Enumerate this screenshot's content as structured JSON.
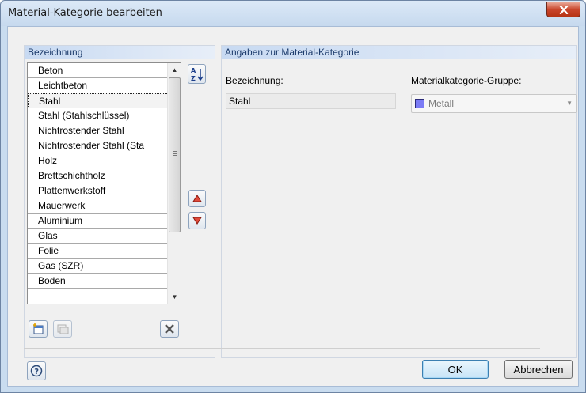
{
  "window": {
    "title": "Material-Kategorie bearbeiten",
    "close_label": "x"
  },
  "left_panel": {
    "header": "Bezeichnung",
    "items": [
      {
        "label": "Beton"
      },
      {
        "label": "Leichtbeton"
      },
      {
        "label": "Stahl",
        "selected": true
      },
      {
        "label": "Stahl (Stahlschlüssel)"
      },
      {
        "label": "Nichtrostender Stahl"
      },
      {
        "label": "Nichtrostender Stahl (Sta"
      },
      {
        "label": "Holz"
      },
      {
        "label": "Brettschichtholz"
      },
      {
        "label": "Plattenwerkstoff"
      },
      {
        "label": "Mauerwerk"
      },
      {
        "label": "Aluminium"
      },
      {
        "label": "Glas"
      },
      {
        "label": "Folie"
      },
      {
        "label": "Gas (SZR)"
      },
      {
        "label": "Boden"
      }
    ],
    "sort_icon_text": "A Z"
  },
  "right_panel": {
    "header": "Angaben zur Material-Kategorie",
    "bezeichnung_label": "Bezeichnung:",
    "bezeichnung_value": "Stahl",
    "gruppe_label": "Materialkategorie-Gruppe:",
    "gruppe_value": "Metall",
    "gruppe_color": "#7b7bf5"
  },
  "footer": {
    "ok_label": "OK",
    "cancel_label": "Abbrechen"
  }
}
